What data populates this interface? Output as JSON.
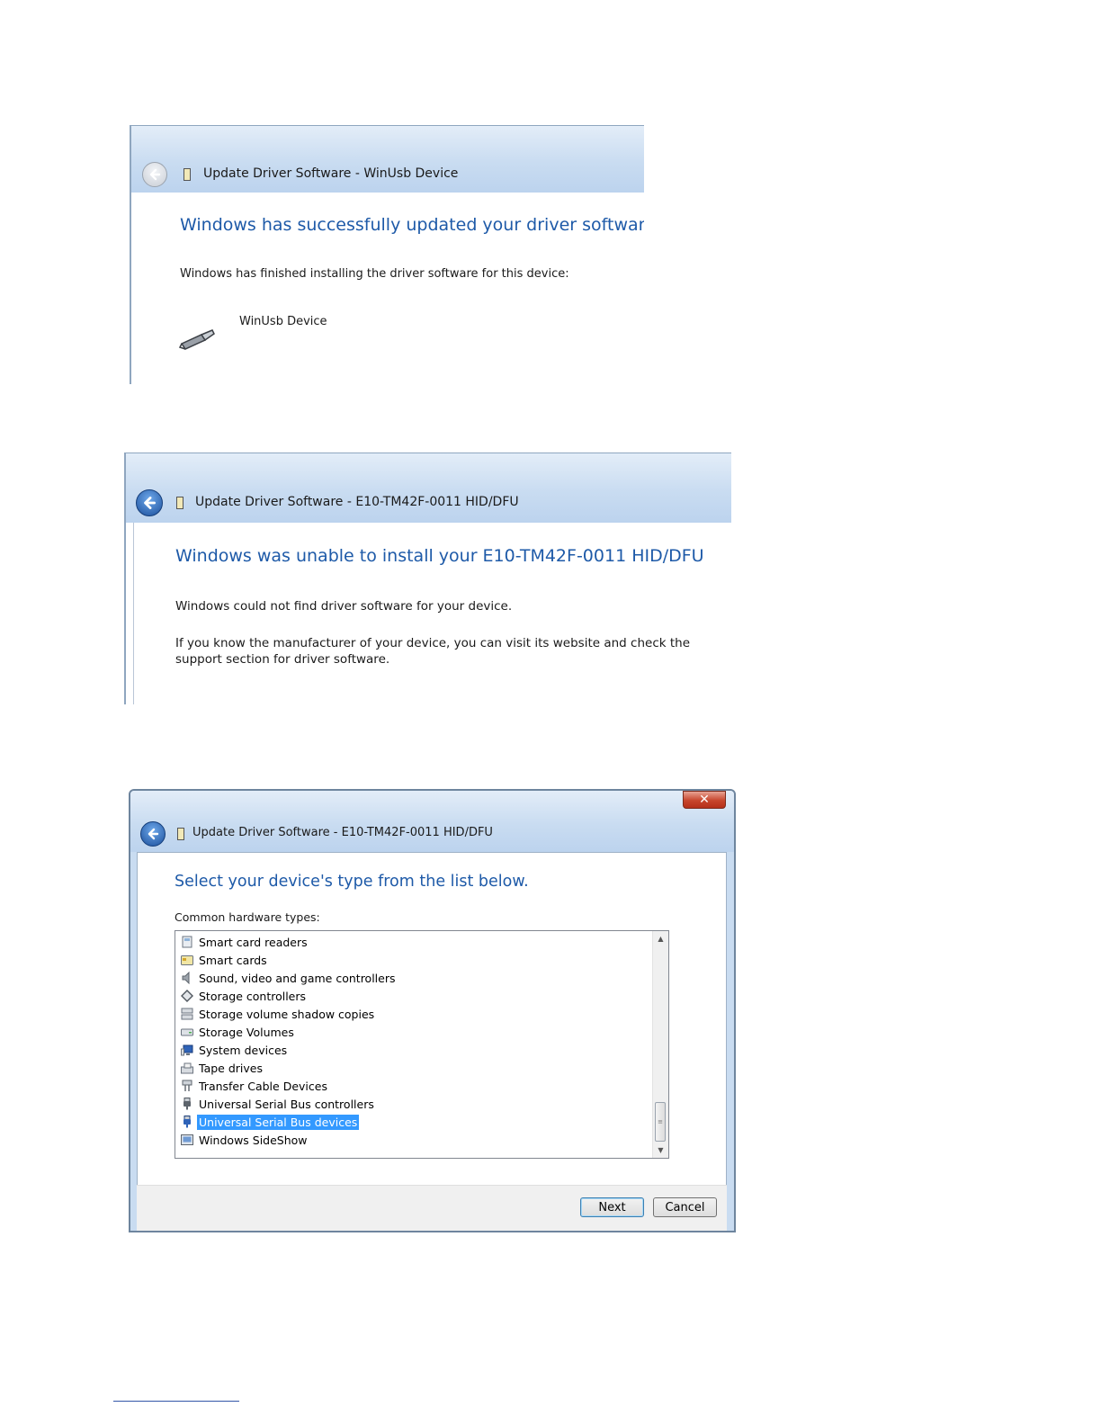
{
  "colors": {
    "heading_blue": "#1e5aa8",
    "titlebar_blue": "#c9dcf1",
    "selection_blue": "#3399ff",
    "close_red": "#c7452c"
  },
  "dialog_success": {
    "title": "Update Driver Software - WinUsb Device",
    "heading": "Windows has successfully updated your driver software",
    "message": "Windows has finished installing the driver software for this device:",
    "device_name": "WinUsb Device",
    "device_icon": "usb-connector-icon",
    "back_icon": "back-arrow-icon"
  },
  "dialog_failure": {
    "title": "Update Driver Software - E10-TM42F-0011 HID/DFU",
    "heading": "Windows was unable to install your E10-TM42F-0011 HID/DFU",
    "message1": "Windows could not find driver software for your device.",
    "message2": "If you know the manufacturer of your device, you can visit its website and check the support section for driver software.",
    "back_icon": "back-arrow-icon"
  },
  "dialog_select": {
    "title": "Update Driver Software - E10-TM42F-0011 HID/DFU",
    "heading": "Select your device's type from the list below.",
    "list_label": "Common hardware types:",
    "close_glyph": "✕",
    "items": [
      {
        "label": "Smart card readers",
        "icon": "smart-card-reader-icon"
      },
      {
        "label": "Smart cards",
        "icon": "smart-card-icon"
      },
      {
        "label": "Sound, video and game controllers",
        "icon": "speaker-icon"
      },
      {
        "label": "Storage controllers",
        "icon": "storage-controller-icon"
      },
      {
        "label": "Storage volume shadow copies",
        "icon": "shadow-copy-icon"
      },
      {
        "label": "Storage Volumes",
        "icon": "storage-volume-icon"
      },
      {
        "label": "System devices",
        "icon": "system-devices-icon"
      },
      {
        "label": "Tape drives",
        "icon": "tape-drive-icon"
      },
      {
        "label": "Transfer Cable Devices",
        "icon": "transfer-cable-icon"
      },
      {
        "label": "Universal Serial Bus controllers",
        "icon": "usb-controller-icon"
      },
      {
        "label": "Universal Serial Bus devices",
        "icon": "usb-device-icon",
        "selected": true
      },
      {
        "label": "Windows SideShow",
        "icon": "sideshow-icon"
      }
    ],
    "next_label": "Next",
    "cancel_label": "Cancel"
  }
}
